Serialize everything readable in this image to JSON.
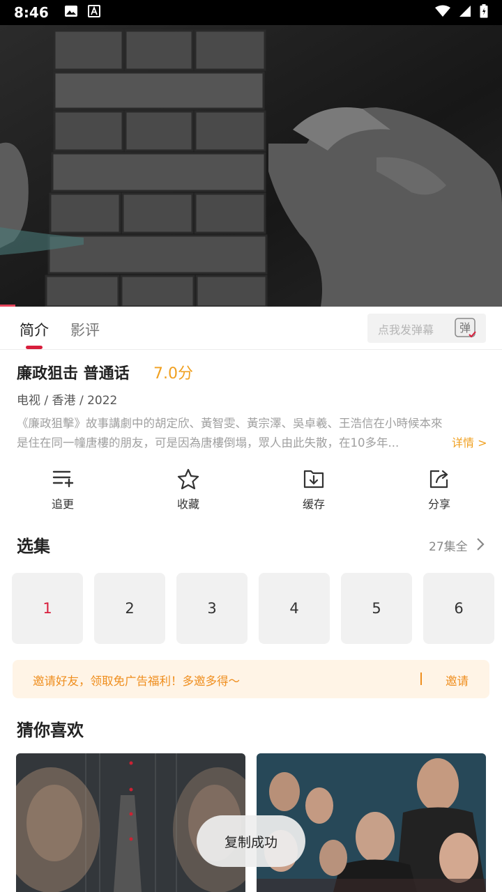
{
  "status_bar": {
    "time": "8:46",
    "icons": [
      "image-icon",
      "font-a-icon",
      "wifi-icon",
      "signal-icon",
      "battery-icon"
    ]
  },
  "video": {
    "description_icon": "video-player"
  },
  "tabs": {
    "intro": "简介",
    "review": "影评"
  },
  "danmaku": {
    "placeholder": "点我发弹幕",
    "button_icon": "danmaku-toggle-icon",
    "button_glyph": "弹"
  },
  "show": {
    "title": "廉政狙击 普通话",
    "score": "7.0分",
    "meta": "电视 / 香港 / 2022",
    "description": "《廉政狙擊》故事講劇中的胡定欣、黃智雯、黃宗澤、吳卓羲、王浩信在小時候本來是住在同一幢唐樓的朋友，可是因為唐樓倒塌，眾人由此失散，在10多年...",
    "detail_link": "详情 >"
  },
  "actions": [
    {
      "label": "追更",
      "icon": "playlist-add-icon"
    },
    {
      "label": "收藏",
      "icon": "star-icon"
    },
    {
      "label": "缓存",
      "icon": "download-folder-icon"
    },
    {
      "label": "分享",
      "icon": "share-icon"
    }
  ],
  "episodes": {
    "title": "选集",
    "count": "27集全",
    "items": [
      "1",
      "2",
      "3",
      "4",
      "5",
      "6"
    ],
    "active_index": 0
  },
  "invite": {
    "text": "邀请好友，领取免广告福利！多邀多得～",
    "button": "邀请"
  },
  "recommendations": {
    "title": "猜你喜欢"
  },
  "toast": {
    "text": "复制成功"
  },
  "colors": {
    "accent": "#d81e3c",
    "score": "#f0a020",
    "invite": "#ef8e1e",
    "invite_bg": "#fff4e6"
  }
}
